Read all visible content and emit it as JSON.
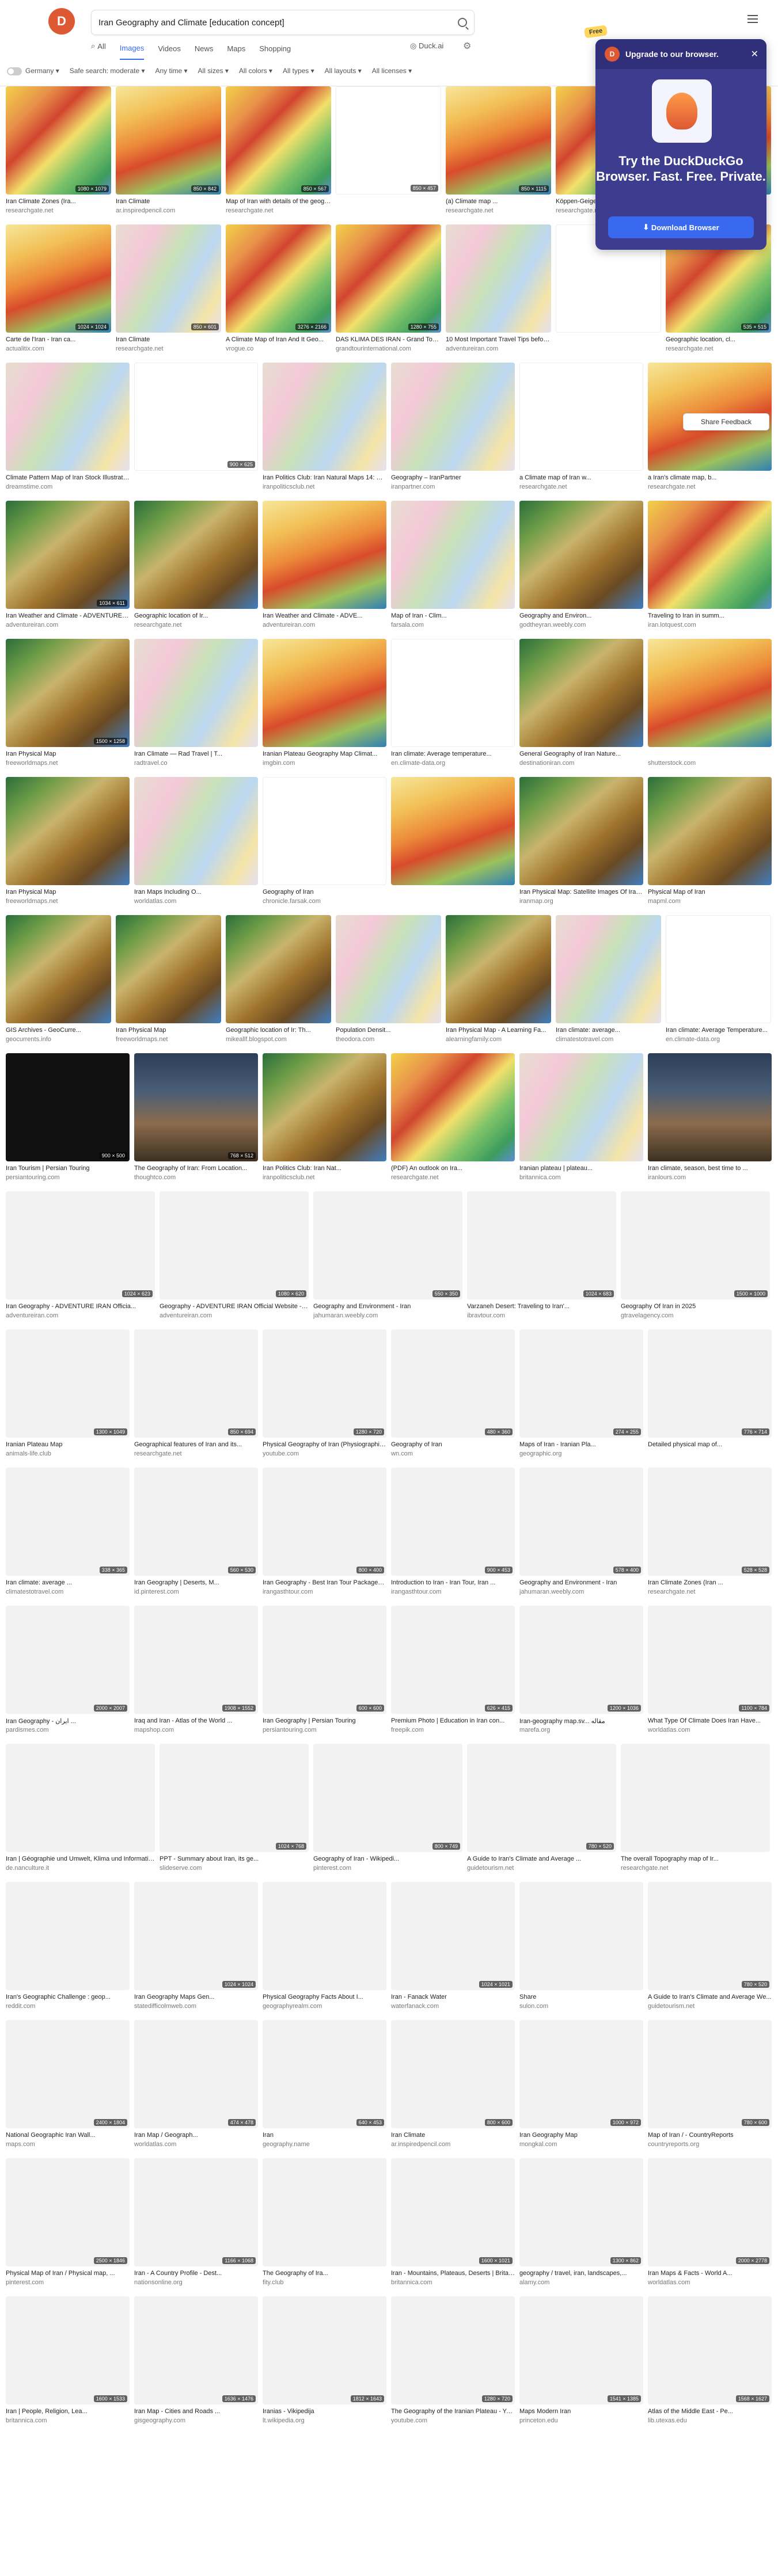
{
  "search": {
    "query": "Iran Geography and Climate [education concept]",
    "placeholder": "Search"
  },
  "tabs": [
    {
      "label": "All",
      "icon": "search-icon"
    },
    {
      "label": "Images",
      "active": true
    },
    {
      "label": "Videos"
    },
    {
      "label": "News"
    },
    {
      "label": "Maps"
    },
    {
      "label": "Shopping"
    }
  ],
  "duckai": "Duck.ai",
  "filters": {
    "region": "Germany",
    "safe_search": "Safe search: moderate",
    "time": "Any time",
    "sizes": "All sizes",
    "colors": "All colors",
    "types": "All types",
    "layouts": "All layouts",
    "licenses": "All licenses"
  },
  "promo": {
    "bar_label": "Upgrade to our browser.",
    "heading": "Try the DuckDuckGo Browser. Fast. Free. Private.",
    "button": "Download Browser",
    "tag": "Free"
  },
  "share_feedback": "Share Feedback",
  "rows": [
    [
      {
        "title": "Iran Climate Zones (Ira...",
        "source": "researchgate.net",
        "badge": "1080 × 1079",
        "kind": "map"
      },
      {
        "title": "Iran Climate",
        "source": "ar.inspiredpencil.com",
        "badge": "850 × 842",
        "kind": "map2"
      },
      {
        "title": "Map of Iran with details of the geographic location a...",
        "source": "researchgate.net",
        "badge": "850 × 567",
        "kind": "map"
      },
      {
        "title": "",
        "source": "",
        "badge": "850 × 457",
        "kind": "chart"
      },
      {
        "title": "(a) Climate map ...",
        "source": "researchgate.net",
        "badge": "850 × 1115",
        "kind": "map2"
      },
      {
        "title": "Köppen-Geiger climate cl...",
        "source": "researchgate.net",
        "badge": "3290 × 3335",
        "kind": "map"
      },
      {
        "title": "Iran",
        "source": "res",
        "badge": "",
        "kind": "map2"
      }
    ],
    [
      {
        "title": "Carte de l'Iran - Iran ca...",
        "source": "actualitix.com",
        "badge": "1024 × 1024",
        "kind": "map2"
      },
      {
        "title": "Iran Climate",
        "source": "researchgate.net",
        "badge": "850 × 601",
        "kind": "political"
      },
      {
        "title": "A Climate Map of Iran And It Geo...",
        "source": "vrogue.co",
        "badge": "3276 × 2166",
        "kind": "map"
      },
      {
        "title": "DAS KLIMA DES IRAN - Grand Tour Internati...",
        "source": "grandtourinternational.com",
        "badge": "1280 × 755",
        "kind": "map"
      },
      {
        "title": "10 Most Important Travel Tips before Travel to Ir...",
        "source": "adventureiran.com",
        "badge": "",
        "kind": "political"
      },
      {
        "title": "",
        "source": "",
        "badge": "",
        "kind": "chart"
      },
      {
        "title": "Geographic location, cl...",
        "source": "researchgate.net",
        "badge": "535 × 515",
        "kind": "map"
      }
    ],
    [
      {
        "title": "Climate Pattern Map of Iran Stock Illustration - Ill...",
        "source": "dreamstime.com",
        "badge": "",
        "kind": "political"
      },
      {
        "title": "",
        "source": "",
        "badge": "900 × 625",
        "kind": "chart"
      },
      {
        "title": "Iran Politics Club: Iran Natural Maps 14: Cr...",
        "source": "iranpoliticsclub.net",
        "badge": "",
        "kind": "political"
      },
      {
        "title": "Geography – IranPartner",
        "source": "iranpartner.com",
        "badge": "",
        "kind": "political"
      },
      {
        "title": "a Climate map of Iran w...",
        "source": "researchgate.net",
        "badge": "",
        "kind": "chart"
      },
      {
        "title": "a Iran's climate map, b...",
        "source": "researchgate.net",
        "badge": "",
        "kind": "map2"
      }
    ],
    [
      {
        "title": "Iran Weather and Climate - ADVENTURE IRAN Official Webs...",
        "source": "adventureiran.com",
        "badge": "1034 × 611",
        "kind": "relief"
      },
      {
        "title": "Geographic location of Ir...",
        "source": "researchgate.net",
        "badge": "",
        "kind": "relief"
      },
      {
        "title": "Iran Weather and Climate - ADVE...",
        "source": "adventureiran.com",
        "badge": "",
        "kind": "map2"
      },
      {
        "title": "Map of Iran - Clim...",
        "source": "farsala.com",
        "badge": "",
        "kind": "political"
      },
      {
        "title": "Geography and Environ...",
        "source": "godtheyran.weebly.com",
        "badge": "",
        "kind": "relief"
      },
      {
        "title": "Traveling to Iran in summ...",
        "source": "iran.lotquest.com",
        "badge": "",
        "kind": "map"
      }
    ],
    [
      {
        "title": "Iran Physical Map",
        "source": "freeworldmaps.net",
        "badge": "1500 × 1258",
        "kind": "relief"
      },
      {
        "title": "Iran Climate — Rad Travel | T...",
        "source": "radtravel.co",
        "badge": "",
        "kind": "political"
      },
      {
        "title": "Iranian Plateau Geography Map Climat...",
        "source": "imgbin.com",
        "badge": "",
        "kind": "map2"
      },
      {
        "title": "Iran climate: Average temperature...",
        "source": "en.climate-data.org",
        "badge": "",
        "kind": "chart"
      },
      {
        "title": "General Geography of Iran Nature...",
        "source": "destinationiran.com",
        "badge": "",
        "kind": "relief"
      },
      {
        "title": "",
        "source": "shutterstock.com",
        "badge": "",
        "kind": "map2"
      }
    ],
    [
      {
        "title": "Iran Physical Map",
        "source": "freeworldmaps.net",
        "badge": "",
        "kind": "relief"
      },
      {
        "title": "Iran Maps Including O...",
        "source": "worldatlas.com",
        "badge": "",
        "kind": "political"
      },
      {
        "title": "Geography of Iran",
        "source": "chronicle.farsak.com",
        "badge": "",
        "kind": "chart"
      },
      {
        "title": "",
        "source": "",
        "badge": "",
        "kind": "map2"
      },
      {
        "title": "Iran Physical Map: Satellite Images Of Iran - Geographic...",
        "source": "iranmap.org",
        "badge": "",
        "kind": "relief"
      },
      {
        "title": "Physical Map of Iran",
        "source": "mapml.com",
        "badge": "",
        "kind": "relief"
      }
    ],
    [
      {
        "title": "GIS Archives - GeoCurre...",
        "source": "geocurrents.info",
        "badge": "",
        "kind": "relief"
      },
      {
        "title": "Iran Physical Map",
        "source": "freeworldmaps.net",
        "badge": "",
        "kind": "relief"
      },
      {
        "title": "Geographic location of Ir: Th...",
        "source": "mikeallf.blogspot.com",
        "badge": "",
        "kind": "relief"
      },
      {
        "title": "Population Densit...",
        "source": "theodora.com",
        "badge": "",
        "kind": "political"
      },
      {
        "title": "Iran Physical Map - A Learning Fa...",
        "source": "alearningfamily.com",
        "badge": "",
        "kind": "relief"
      },
      {
        "title": "Iran climate: average...",
        "source": "climatestotravel.com",
        "badge": "",
        "kind": "political"
      },
      {
        "title": "Iran climate: Average Temperature...",
        "source": "en.climate-data.org",
        "badge": "",
        "kind": "chart"
      }
    ],
    [
      {
        "title": "Iran Tourism | Persian Touring",
        "source": "persiantouring.com",
        "badge": "900 × 500",
        "kind": "dark"
      },
      {
        "title": "The Geography of Iran: From Location...",
        "source": "thoughtco.com",
        "badge": "768 × 512",
        "kind": "photo"
      },
      {
        "title": "Iran Politics Club: Iran Nat...",
        "source": "iranpoliticsclub.net",
        "badge": "",
        "kind": "relief"
      },
      {
        "title": "(PDF) An outlook on Ira...",
        "source": "researchgate.net",
        "badge": "",
        "kind": "map"
      },
      {
        "title": "Iranian plateau | plateau...",
        "source": "britannica.com",
        "badge": "",
        "kind": "political"
      },
      {
        "title": "Iran climate, season, best time to ...",
        "source": "iranlours.com",
        "badge": "",
        "kind": "photo"
      }
    ],
    [
      {
        "title": "Iran Geography - ADVENTURE IRAN Officia...",
        "source": "adventureiran.com",
        "badge": "1024 × 623",
        "kind": "blank"
      },
      {
        "title": "Geography - ADVENTURE IRAN Official Website - Irani...",
        "source": "adventureiran.com",
        "badge": "1080 × 620",
        "kind": "blank"
      },
      {
        "title": "Geography and Environment - Iran",
        "source": "jahumaran.weebly.com",
        "badge": "550 × 350",
        "kind": "blank"
      },
      {
        "title": "Varzaneh Desert: Traveling to Iran'...",
        "source": "ibravtour.com",
        "badge": "1024 × 683",
        "kind": "blank"
      },
      {
        "title": "Geography Of Iran in 2025",
        "source": "gtravelagency.com",
        "badge": "1500 × 1000",
        "kind": "blank"
      }
    ],
    [
      {
        "title": "Iranian Plateau Map",
        "source": "animals-life.club",
        "badge": "1300 × 1049",
        "kind": "blank"
      },
      {
        "title": "Geographical features of Iran and its...",
        "source": "researchgate.net",
        "badge": "850 × 694",
        "kind": "blank"
      },
      {
        "title": "Physical Geography of Iran (Physiographic Ma...",
        "source": "youtube.com",
        "badge": "1280 × 720",
        "kind": "blank"
      },
      {
        "title": "Geography of Iran",
        "source": "wn.com",
        "badge": "480 × 360",
        "kind": "blank"
      },
      {
        "title": "Maps of Iran - Iranian Pla...",
        "source": "geographic.org",
        "badge": "274 × 255",
        "kind": "blank"
      },
      {
        "title": "Detailed physical map of...",
        "source": "",
        "badge": "776 × 714",
        "kind": "blank"
      }
    ],
    [
      {
        "title": "Iran climate: average ...",
        "source": "climatestotravel.com",
        "badge": "338 × 365",
        "kind": "blank"
      },
      {
        "title": "Iran Geography | Deserts, M...",
        "source": "id.pinterest.com",
        "badge": "560 × 530",
        "kind": "blank"
      },
      {
        "title": "Iran Geography - Best Iran Tour Packages 2024",
        "source": "irangasthtour.com",
        "badge": "800 × 400",
        "kind": "blank"
      },
      {
        "title": "Introduction to Iran - Iran Tour, Iran ...",
        "source": "irangasthtour.com",
        "badge": "900 × 453",
        "kind": "blank"
      },
      {
        "title": "Geography and Environment - Iran",
        "source": "jahumaran.weebly.com",
        "badge": "578 × 400",
        "kind": "blank"
      },
      {
        "title": "Iran Climate Zones (Iran ...",
        "source": "researchgate.net",
        "badge": "528 × 528",
        "kind": "blank"
      }
    ],
    [
      {
        "title": "Iran Geography - ایران ...",
        "source": "pardismes.com",
        "badge": "2000 × 2007",
        "kind": "blank"
      },
      {
        "title": "Iraq and Iran - Atlas of the World ...",
        "source": "mapshop.com",
        "badge": "1908 × 1552",
        "kind": "blank"
      },
      {
        "title": "Iran Geography | Persian Touring",
        "source": "persiantouring.com",
        "badge": "600 × 600",
        "kind": "blank"
      },
      {
        "title": "Premium Photo | Education in Iran con...",
        "source": "freepik.com",
        "badge": "626 × 415",
        "kind": "blank"
      },
      {
        "title": "Iran-geography map.sv... مقاله",
        "source": "marefa.org",
        "badge": "1200 × 1036",
        "kind": "blank"
      },
      {
        "title": "What Type Of Climate Does Iran Have...",
        "source": "worldatlas.com",
        "badge": "1100 × 784",
        "kind": "blank"
      }
    ],
    [
      {
        "title": "Iran | Géographie und Umwelt, Klima und Informationen über das...",
        "source": "de.nanculture.it",
        "badge": "",
        "kind": "blank"
      },
      {
        "title": "PPT - Summary about Iran, its ge...",
        "source": "slideserve.com",
        "badge": "1024 × 768",
        "kind": "blank"
      },
      {
        "title": "Geography of Iran - Wikipedi...",
        "source": "pinterest.com",
        "badge": "800 × 749",
        "kind": "blank"
      },
      {
        "title": "A Guide to Iran's Climate and Average ...",
        "source": "guidetourism.net",
        "badge": "780 × 520",
        "kind": "blank"
      },
      {
        "title": "The overall Topography map of Ir...",
        "source": "researchgate.net",
        "badge": "",
        "kind": "blank"
      }
    ],
    [
      {
        "title": "Iran's Geographic Challenge : geop...",
        "source": "reddit.com",
        "badge": "",
        "kind": "blank"
      },
      {
        "title": "Iran Geography Maps Gen...",
        "source": "statedifficolmweb.com",
        "badge": "1024 × 1024",
        "kind": "blank"
      },
      {
        "title": "Physical Geography Facts About I...",
        "source": "geographyrealm.com",
        "badge": "",
        "kind": "blank"
      },
      {
        "title": "Iran - Fanack Water",
        "source": "waterfanack.com",
        "badge": "1024 × 1021",
        "kind": "blank"
      },
      {
        "title": "Share",
        "source": "sulon.com",
        "badge": "",
        "kind": "blank"
      },
      {
        "title": "A Guide to Iran's Climate and Average We...",
        "source": "guidetourism.net",
        "badge": "780 × 520",
        "kind": "blank"
      }
    ],
    [
      {
        "title": "National Geographic Iran Wall...",
        "source": "maps.com",
        "badge": "2400 × 1804",
        "kind": "blank"
      },
      {
        "title": "Iran Map / Geograph...",
        "source": "worldatlas.com",
        "badge": "474 × 478",
        "kind": "blank"
      },
      {
        "title": "Iran",
        "source": "geography.name",
        "badge": "640 × 453",
        "kind": "blank"
      },
      {
        "title": "Iran Climate",
        "source": "ar.inspiredpencil.com",
        "badge": "800 × 600",
        "kind": "blank"
      },
      {
        "title": "Iran Geography Map",
        "source": "mongkal.com",
        "badge": "1000 × 972",
        "kind": "blank"
      },
      {
        "title": "Map of Iran / - CountryReports",
        "source": "countryreports.org",
        "badge": "780 × 600",
        "kind": "blank"
      }
    ],
    [
      {
        "title": "Physical Map of Iran / Physical map, ...",
        "source": "pinterest.com",
        "badge": "2500 × 1846",
        "kind": "blank"
      },
      {
        "title": "Iran - A Country Profile - Dest...",
        "source": "nationsonline.org",
        "badge": "1166 × 1068",
        "kind": "blank"
      },
      {
        "title": "The Geography of Ira...",
        "source": "fity.club",
        "badge": "",
        "kind": "blank"
      },
      {
        "title": "Iran - Mountains, Plateaus, Deserts | Britan...",
        "source": "britannica.com",
        "badge": "1600 × 1021",
        "kind": "blank"
      },
      {
        "title": "geography / travel, iran, landscapes,...",
        "source": "alamy.com",
        "badge": "1300 × 862",
        "kind": "blank"
      },
      {
        "title": "Iran Maps & Facts - World A...",
        "source": "worldatlas.com",
        "badge": "2000 × 2778",
        "kind": "blank"
      }
    ],
    [
      {
        "title": "Iran | People, Religion, Lea...",
        "source": "britannica.com",
        "badge": "1600 × 1533",
        "kind": "blank"
      },
      {
        "title": "Iran Map - Cities and Roads ...",
        "source": "gisgeography.com",
        "badge": "1636 × 1476",
        "kind": "blank"
      },
      {
        "title": "Iranias - Vikipedija",
        "source": "lt.wikipedia.org",
        "badge": "1812 × 1643",
        "kind": "blank"
      },
      {
        "title": "The Geography of the Iranian Plateau - YouTube",
        "source": "youtube.com",
        "badge": "1280 × 720",
        "kind": "blank"
      },
      {
        "title": "Maps Modern Iran",
        "source": "princeton.edu",
        "badge": "1541 × 1385",
        "kind": "blank"
      },
      {
        "title": "Atlas of the Middle East - Pe...",
        "source": "lib.utexas.edu",
        "badge": "1568 × 1627",
        "kind": "blank"
      }
    ]
  ]
}
